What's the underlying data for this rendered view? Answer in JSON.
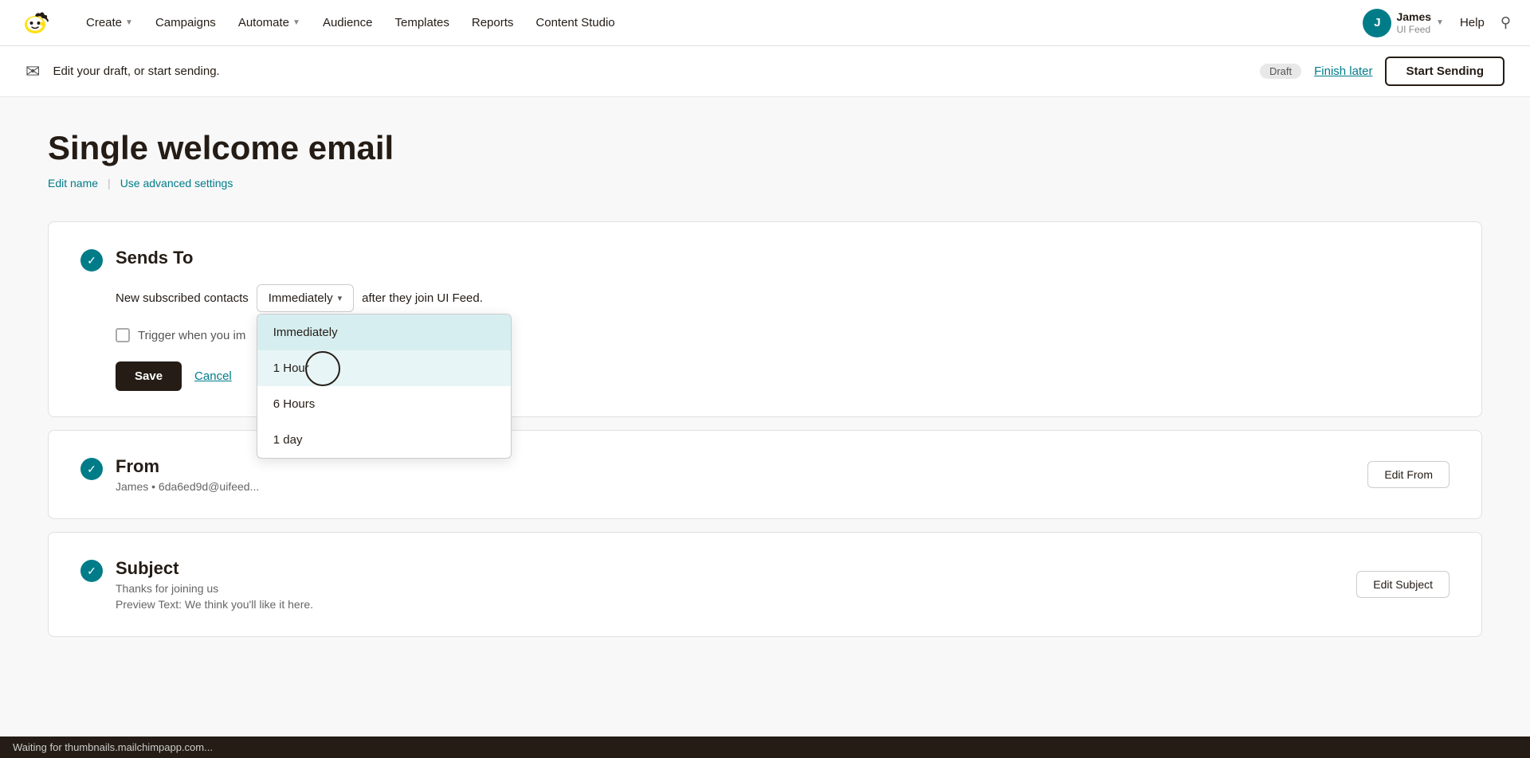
{
  "brand": {
    "name": "Mailchimp"
  },
  "topnav": {
    "links": [
      {
        "label": "Create",
        "has_dropdown": true
      },
      {
        "label": "Campaigns",
        "has_dropdown": false
      },
      {
        "label": "Automate",
        "has_dropdown": true
      },
      {
        "label": "Audience",
        "has_dropdown": false
      },
      {
        "label": "Templates",
        "has_dropdown": false
      },
      {
        "label": "Reports",
        "has_dropdown": false
      },
      {
        "label": "Content Studio",
        "has_dropdown": false
      }
    ],
    "help_label": "Help",
    "user": {
      "initial": "J",
      "name": "James",
      "subtitle": "UI Feed"
    }
  },
  "draft_bar": {
    "icon": "✉",
    "text": "Edit your draft, or start sending.",
    "badge": "Draft",
    "finish_later": "Finish later",
    "start_sending": "Start Sending"
  },
  "page": {
    "title": "Single welcome email",
    "edit_name_label": "Edit name",
    "advanced_settings_label": "Use advanced settings"
  },
  "sends_to": {
    "section_title": "Sends To",
    "check_icon": "✓",
    "description_before": "New subscribed contacts",
    "description_after": "after they join UI Feed.",
    "dropdown_value": "Immediately",
    "dropdown_options": [
      {
        "label": "Immediately",
        "selected": true,
        "hovered": false
      },
      {
        "label": "1 Hour",
        "selected": false,
        "hovered": true
      },
      {
        "label": "6 Hours",
        "selected": false,
        "hovered": false
      },
      {
        "label": "1 day",
        "selected": false,
        "hovered": false
      }
    ],
    "trigger_checkbox_label": "Trigger when you im",
    "save_label": "Save",
    "cancel_label": "Cancel"
  },
  "from_section": {
    "section_title": "From",
    "check_icon": "✓",
    "from_value": "James • 6da6ed9d@uifeed...",
    "edit_button": "Edit From"
  },
  "subject_section": {
    "section_title": "Subject",
    "check_icon": "✓",
    "subject_value": "Thanks for joining us",
    "preview_text": "Preview Text: We think you'll like it here.",
    "edit_button": "Edit Subject"
  },
  "status_bar": {
    "text": "Waiting for thumbnails.mailchimpapp.com..."
  }
}
